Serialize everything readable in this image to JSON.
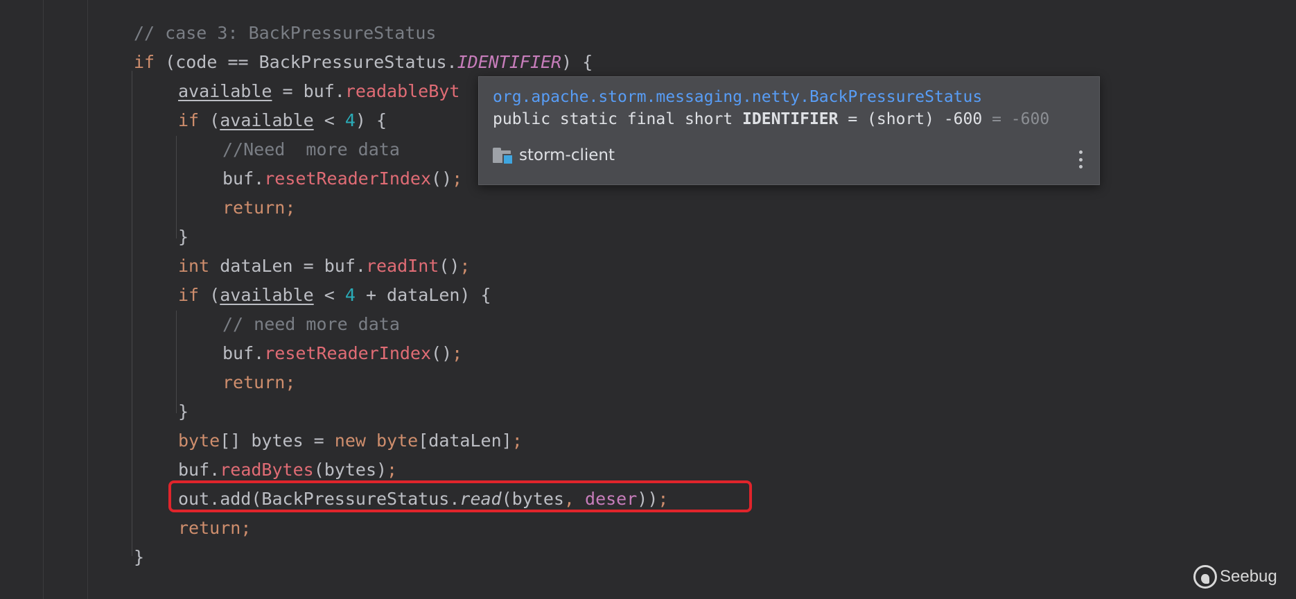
{
  "editor": {
    "lines": [
      {
        "id": "l1",
        "segments": [
          [
            "cm",
            "// case 3: BackPressureStatus"
          ]
        ]
      },
      {
        "id": "l2",
        "segments": [
          [
            "kw",
            "if "
          ],
          [
            "punct",
            "(code == BackPressureStatus."
          ],
          [
            "fld",
            "IDENTIFIER"
          ],
          [
            "punct",
            ") {"
          ]
        ]
      },
      {
        "id": "l3",
        "segments": [
          [
            "var-u",
            "available"
          ],
          [
            "punct",
            " = buf."
          ],
          [
            "mth",
            "readableByt"
          ]
        ]
      },
      {
        "id": "l4",
        "segments": [
          [
            "kw",
            "if "
          ],
          [
            "punct",
            "("
          ],
          [
            "var-u",
            "available"
          ],
          [
            "punct",
            " < "
          ],
          [
            "num",
            "4"
          ],
          [
            "punct",
            ") {"
          ]
        ]
      },
      {
        "id": "l5",
        "segments": [
          [
            "cm",
            "//Need  more data"
          ]
        ]
      },
      {
        "id": "l6",
        "segments": [
          [
            "punct",
            "buf."
          ],
          [
            "mth",
            "resetReaderIndex"
          ],
          [
            "punct",
            "()"
          ],
          [
            "semi",
            ";"
          ]
        ]
      },
      {
        "id": "l7",
        "segments": [
          [
            "kw",
            "return"
          ],
          [
            "semi",
            ";"
          ]
        ]
      },
      {
        "id": "l8",
        "segments": [
          [
            "punct",
            "}"
          ]
        ]
      },
      {
        "id": "l9",
        "segments": [
          [
            "kw",
            "int "
          ],
          [
            "punct",
            "dataLen = buf."
          ],
          [
            "mth",
            "readInt"
          ],
          [
            "punct",
            "()"
          ],
          [
            "semi",
            ";"
          ]
        ]
      },
      {
        "id": "l10",
        "segments": [
          [
            "kw",
            "if "
          ],
          [
            "punct",
            "("
          ],
          [
            "var-u",
            "available"
          ],
          [
            "punct",
            " < "
          ],
          [
            "num",
            "4"
          ],
          [
            "punct",
            " + dataLen) {"
          ]
        ]
      },
      {
        "id": "l11",
        "segments": [
          [
            "cm",
            "// need more data"
          ]
        ]
      },
      {
        "id": "l12",
        "segments": [
          [
            "punct",
            "buf."
          ],
          [
            "mth",
            "resetReaderIndex"
          ],
          [
            "punct",
            "()"
          ],
          [
            "semi",
            ";"
          ]
        ]
      },
      {
        "id": "l13",
        "segments": [
          [
            "kw",
            "return"
          ],
          [
            "semi",
            ";"
          ]
        ]
      },
      {
        "id": "l14",
        "segments": [
          [
            "punct",
            "}"
          ]
        ]
      },
      {
        "id": "l15",
        "segments": [
          [
            "kw",
            "byte"
          ],
          [
            "punct",
            "[] bytes = "
          ],
          [
            "kw",
            "new byte"
          ],
          [
            "punct",
            "[dataLen]"
          ],
          [
            "semi",
            ";"
          ]
        ]
      },
      {
        "id": "l16",
        "segments": [
          [
            "punct",
            "buf."
          ],
          [
            "mth",
            "readBytes"
          ],
          [
            "punct",
            "(bytes)"
          ],
          [
            "semi",
            ";"
          ]
        ]
      },
      {
        "id": "l17",
        "segments": [
          [
            "punct",
            "out.add(BackPressureStatus."
          ],
          [
            "stat",
            "read"
          ],
          [
            "punct",
            "(bytes"
          ],
          [
            "semi",
            ", "
          ],
          [
            "param",
            "deser"
          ],
          [
            "punct",
            "))"
          ],
          [
            "semi",
            ";"
          ]
        ]
      },
      {
        "id": "l18",
        "segments": [
          [
            "kw",
            "return"
          ],
          [
            "semi",
            ";"
          ]
        ]
      },
      {
        "id": "l19",
        "segments": [
          [
            "punct",
            "}"
          ]
        ]
      }
    ]
  },
  "popup": {
    "fqn": "org.apache.storm.messaging.netty.BackPressureStatus",
    "decl_prefix": "public static final short ",
    "decl_name": "IDENTIFIER",
    "decl_value": " = (short) -600",
    "decl_computed": " = -600",
    "module_icon": "module-folder-icon",
    "module_name": "storm-client",
    "more_icon": "more-vertical-icon"
  },
  "highlight": {
    "color": "#e0242b"
  },
  "watermark": {
    "text": "Seebug",
    "icon": "seebug-logo-icon"
  }
}
